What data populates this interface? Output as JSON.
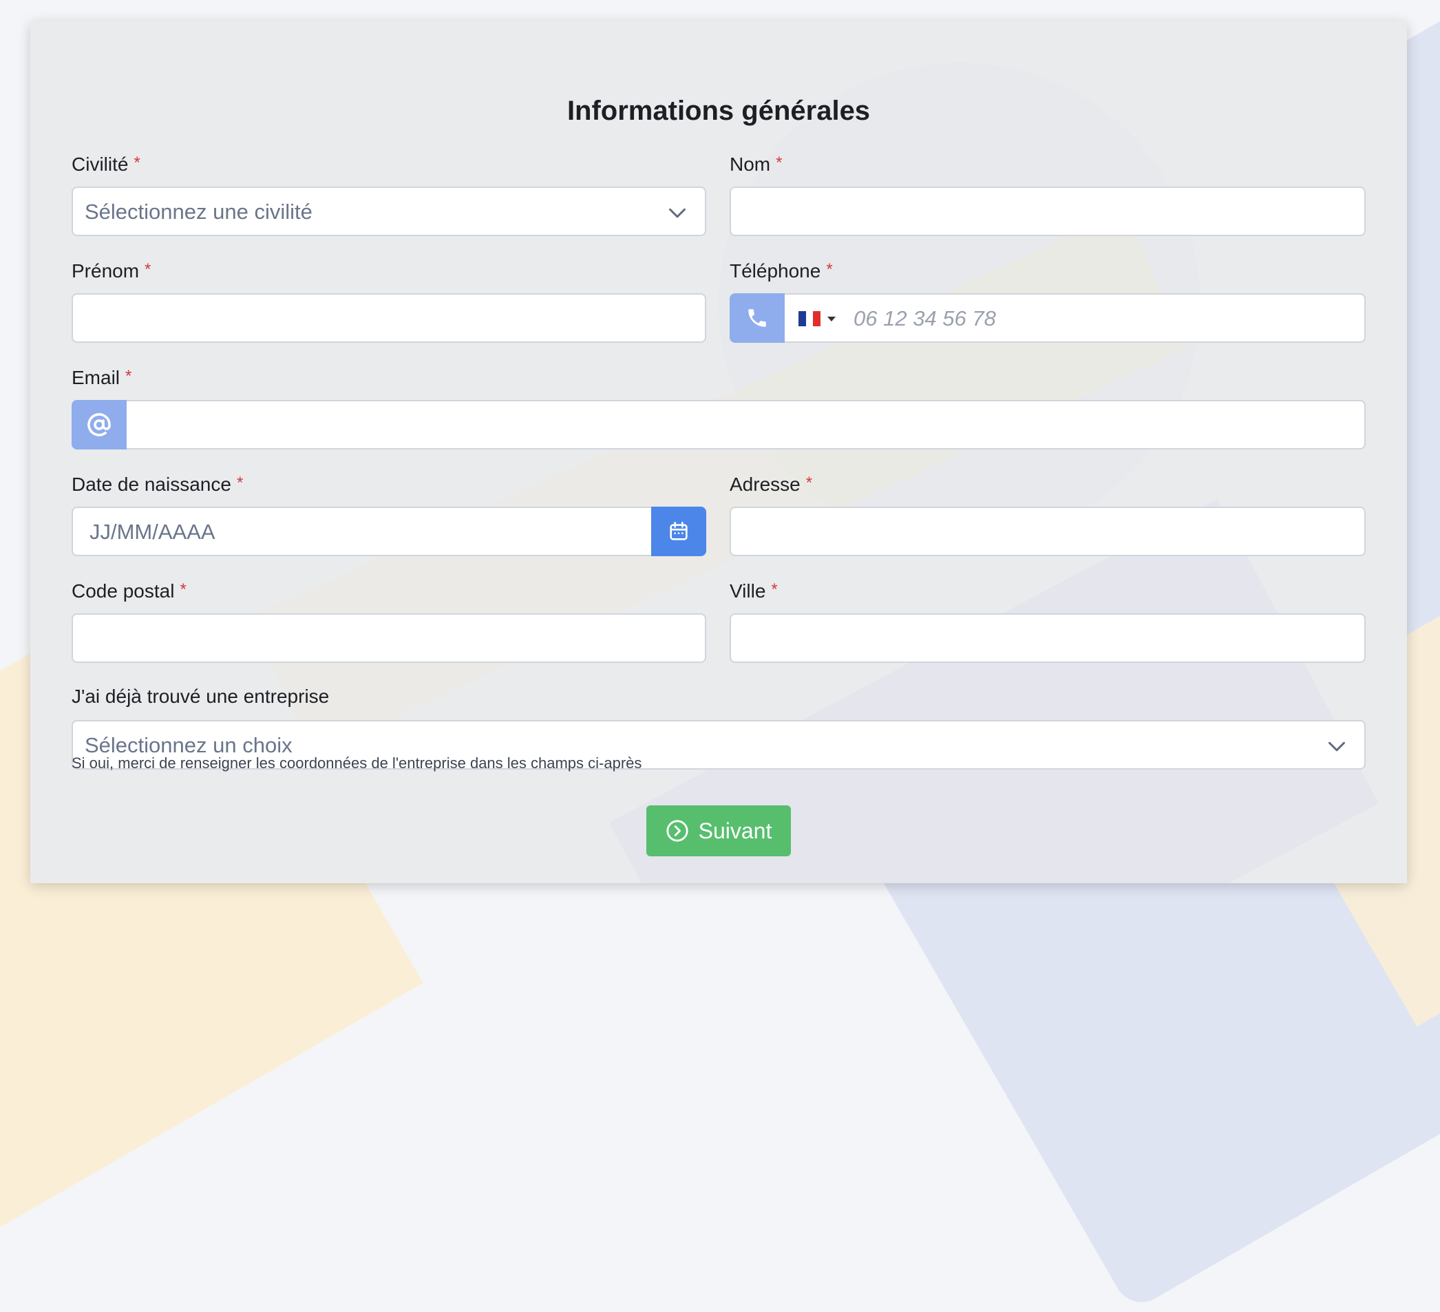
{
  "form": {
    "title": "Informations générales",
    "required_mark": "*",
    "civilite": {
      "label": "Civilité",
      "placeholder": "Sélectionnez une civilité"
    },
    "nom": {
      "label": "Nom",
      "value": ""
    },
    "prenom": {
      "label": "Prénom",
      "value": ""
    },
    "telephone": {
      "label": "Téléphone",
      "placeholder": "06 12 34 56 78",
      "country_flag": "france-flag-icon"
    },
    "email": {
      "label": "Email",
      "value": "",
      "icon": "at-sign-icon"
    },
    "date_naissance": {
      "label": "Date de naissance",
      "placeholder": "JJ/MM/AAAA",
      "icon": "calendar-icon"
    },
    "adresse": {
      "label": "Adresse",
      "value": ""
    },
    "code_postal": {
      "label": "Code postal",
      "value": ""
    },
    "ville": {
      "label": "Ville",
      "value": ""
    },
    "entreprise": {
      "label": "J'ai déjà trouvé une entreprise",
      "placeholder": "Sélectionnez un choix",
      "help": "Si oui, merci de renseigner les coordonnées de l'entreprise dans les champs ci-après"
    },
    "next_button": {
      "label": "Suivant",
      "icon": "chevron-right-circle-icon"
    }
  },
  "colors": {
    "required": "#d53a3a",
    "addon_light": "#8fadec",
    "addon_primary": "#4c86e9",
    "button_green": "#57be6e"
  }
}
